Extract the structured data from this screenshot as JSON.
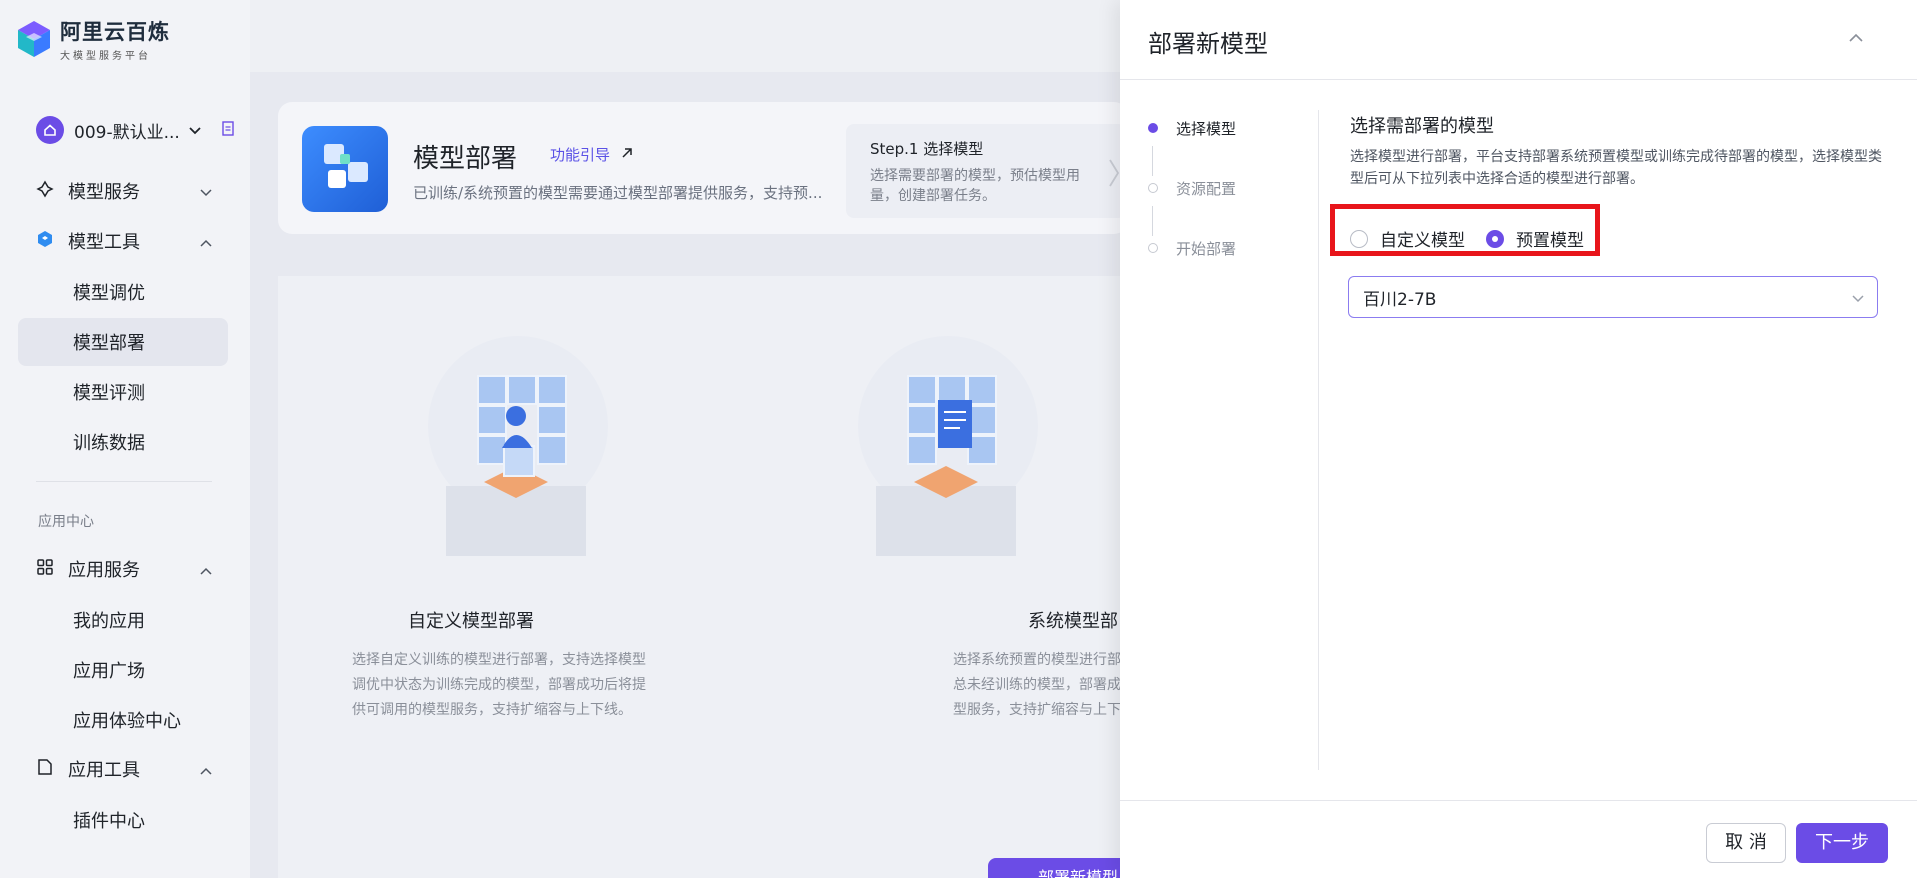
{
  "brand": {
    "title": "阿里云百炼",
    "subtitle": "大模型服务平台"
  },
  "workspace": {
    "name": "009-默认业..."
  },
  "nav": {
    "model_service": "模型服务",
    "model_tools": "模型工具",
    "model_tools_items": [
      "模型调优",
      "模型部署",
      "模型评测",
      "训练数据"
    ],
    "section_label": "应用中心",
    "app_service": "应用服务",
    "app_service_items": [
      "我的应用",
      "应用广场",
      "应用体验中心"
    ],
    "app_tools": "应用工具",
    "app_tools_items": [
      "插件中心"
    ],
    "active_item": "模型部署"
  },
  "hero": {
    "title": "模型部署",
    "guide_link": "功能引导",
    "description": "已训练/系统预置的模型需要通过模型部署提供服务，支持预...",
    "step_title": "Step.1 选择模型",
    "step_desc": "选择需要部署的模型，预估模型用量，创建部署任务。"
  },
  "cards": [
    {
      "title": "自定义模型部署",
      "desc": [
        "选择自定义训练的模型进行部署，支持选择模型",
        "调优中状态为训练完成的模型，部署成功后将提",
        "供可调用的模型服务，支持扩缩容与上下线。"
      ]
    },
    {
      "title": "系统模型部",
      "desc": [
        "选择系统预置的模型进行部署",
        "总未经训练的模型，部署成功",
        "型服务，支持扩缩容与上下线"
      ]
    }
  ],
  "deploy_button": "部署新模型",
  "drawer": {
    "title": "部署新模型",
    "steps": [
      {
        "label": "选择模型",
        "state": "active"
      },
      {
        "label": "资源配置",
        "state": "todo"
      },
      {
        "label": "开始部署",
        "state": "todo"
      }
    ],
    "form_title": "选择需部署的模型",
    "form_desc": "选择模型进行部署，平台支持部署系统预置模型或训练完成待部署的模型，选择模型类型后可从下拉列表中选择合适的模型进行部署。",
    "radio_custom": "自定义模型",
    "radio_preset": "预置模型",
    "selected_radio": "预置模型",
    "selected_model": "百川2-7B",
    "cancel": "取 消",
    "next": "下一步"
  },
  "colors": {
    "accent": "#6b4ce6",
    "highlight": "#e8151b"
  }
}
